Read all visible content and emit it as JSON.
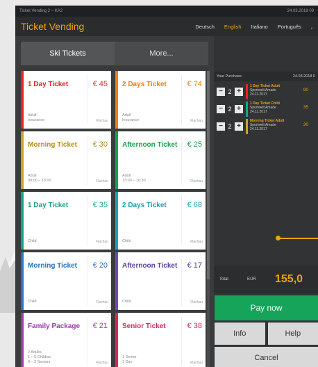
{
  "titlebar": {
    "left": "Ticket Vending 2 – KA2",
    "right": "24.03.2018 09"
  },
  "app": {
    "title": "Ticket Vending"
  },
  "languages": [
    {
      "label": "Deutsch",
      "active": false
    },
    {
      "label": "English",
      "active": true
    },
    {
      "label": "Italiano",
      "active": false
    },
    {
      "label": "Português",
      "active": false
    }
  ],
  "lang_more": ".",
  "tabs": [
    {
      "label": "Ski Tickets",
      "active": true
    },
    {
      "label": "More...",
      "active": false
    }
  ],
  "cards": [
    {
      "name": "1 Day Ticket",
      "price": "€ 45",
      "detail": "Adult\nInsurance",
      "vendor": "Flachau",
      "color": "#e8231f",
      "name_color": "#e8231f",
      "price_color": "#e8231f"
    },
    {
      "name": "2 Days Ticket",
      "price": "€ 74",
      "detail": "Adult\nInsurance",
      "vendor": "Flachau",
      "color": "#f07d0e",
      "name_color": "#f07d0e",
      "price_color": "#f07d0e"
    },
    {
      "name": "Morning Ticket",
      "price": "€ 30",
      "detail": "Adult\n09:00 – 13:00",
      "vendor": "Flachau",
      "color": "#c9a227",
      "name_color": "#b8901a",
      "price_color": "#b8901a"
    },
    {
      "name": "Afternoon Ticket",
      "price": "€ 25",
      "detail": "Adult\n13:00 – 16:30",
      "vendor": "Flachau",
      "color": "#19a04a",
      "name_color": "#19a04a",
      "price_color": "#19a04a"
    },
    {
      "name": "1 Day Ticket",
      "price": "€ 35",
      "detail": "Child",
      "vendor": "Flachau",
      "color": "#17a58a",
      "name_color": "#17a58a",
      "price_color": "#17a58a"
    },
    {
      "name": "2 Days Ticket",
      "price": "€ 68",
      "detail": "Child",
      "vendor": "Flachau",
      "color": "#17a5b0",
      "name_color": "#17a5b0",
      "price_color": "#17a5b0"
    },
    {
      "name": "Morning Ticket",
      "price": "€ 20",
      "detail": "Child",
      "vendor": "Flachau",
      "color": "#2673c8",
      "name_color": "#2673c8",
      "price_color": "#2673c8"
    },
    {
      "name": "Afternoon Ticket",
      "price": "€ 17",
      "detail": "Child",
      "vendor": "Flachau",
      "color": "#6a4bb5",
      "name_color": "#5a3e9e",
      "price_color": "#5a3e9e"
    },
    {
      "name": "Family Package",
      "price": "€ 21",
      "detail": "2 Adults\n1 – 5 Children\n0 – 2 Seniors",
      "vendor": "Flachau",
      "color": "#9b3aa8",
      "name_color": "#9b3aa8",
      "price_color": "#9b3aa8"
    },
    {
      "name": "Senior Ticket",
      "price": "€ 38",
      "detail": "1 Senior\n1 Day",
      "vendor": "Flachau",
      "color": "#d42a5a",
      "name_color": "#d42a5a",
      "price_color": "#d42a5a"
    }
  ],
  "purchase": {
    "title": "Your Purchase",
    "date": "24.03.2018 0",
    "items": [
      {
        "qty": "2",
        "name": "1 Day Ticket Adult",
        "sub": "Sportwelt Amade\n24.11.2017",
        "price": "90",
        "color": "#e8231f"
      },
      {
        "qty": "2",
        "name": "1 Day Ticket Child",
        "sub": "Sportwelt Amade\n24.11.2017",
        "price": "35",
        "color": "#17a58a"
      },
      {
        "qty": "2",
        "name": "Morning Ticket Adult",
        "sub": "Sportwelt Amade\n24.11.2017",
        "price": "30",
        "color": "#c9a227"
      }
    ]
  },
  "total": {
    "label": "Total",
    "currency": "EUR",
    "value": "155,0"
  },
  "buttons": {
    "pay": "Pay now",
    "info": "Info",
    "help": "Help",
    "cancel": "Cancel"
  }
}
